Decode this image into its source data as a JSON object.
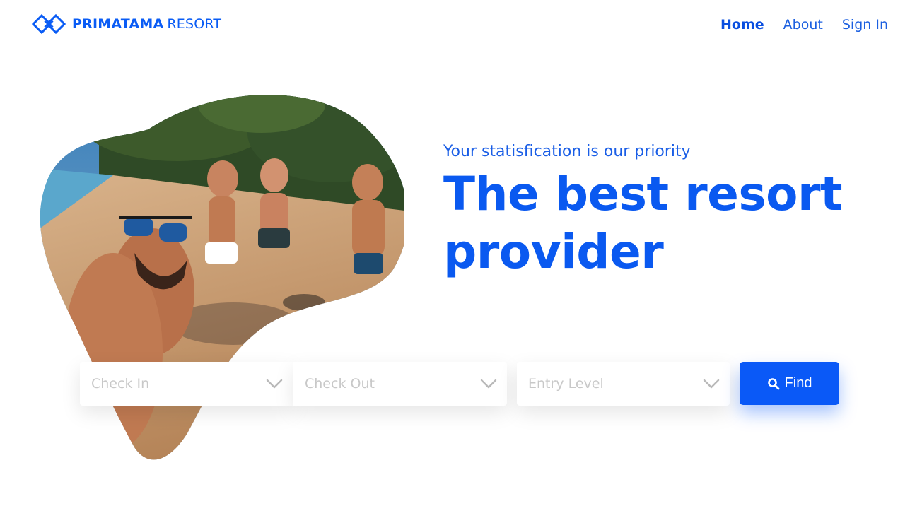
{
  "brand": {
    "name_bold": "PRIMATAMA",
    "name_light": "RESORT",
    "color": "#0a5cf5"
  },
  "nav": {
    "items": [
      {
        "label": "Home",
        "active": true
      },
      {
        "label": "About",
        "active": false
      },
      {
        "label": "Sign In",
        "active": false
      }
    ]
  },
  "hero": {
    "tagline": "Your statisfication is our priority",
    "headline_line1": "The best resort",
    "headline_line2": "provider"
  },
  "search": {
    "check_in_placeholder": "Check In",
    "check_out_placeholder": "Check Out",
    "entry_level_placeholder": "Entry Level",
    "find_label": "Find",
    "chevron_icon": "chevron-down-icon",
    "search_icon": "search-icon"
  },
  "colors": {
    "accent": "#0a59f7",
    "placeholder": "#c8c8c8"
  }
}
